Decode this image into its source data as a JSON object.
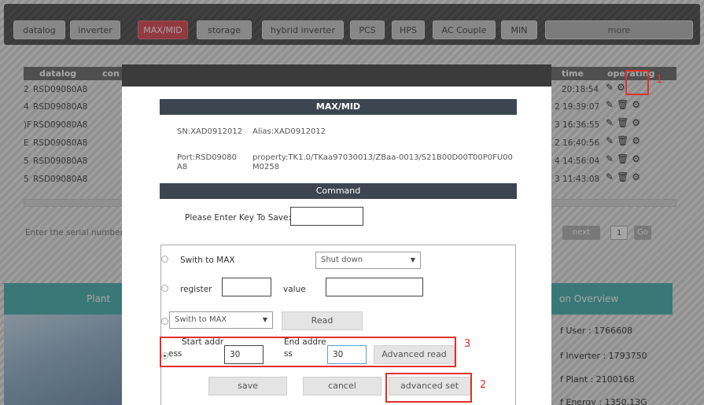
{
  "nav": {
    "tabs": [
      "datalog",
      "inverter",
      "MAX/MID",
      "storage",
      "hybrid inverter",
      "PCS",
      "HPS",
      "AC Couple",
      "MIN",
      "more"
    ],
    "active_tab": "MAX/MID"
  },
  "table": {
    "columns": {
      "datalog": "datalog",
      "con": "con",
      "time": "time",
      "operating": "operating"
    },
    "rows": [
      {
        "idx": "2",
        "datalog": "RSD09080A8",
        "time": "20:18:54"
      },
      {
        "idx": "4",
        "datalog": "RSD09080A8",
        "time": "2 19:39:07"
      },
      {
        "idx": ")F",
        "datalog": "RSD09080A8",
        "time": "3 16:36:55"
      },
      {
        "idx": "E",
        "datalog": "RSD09080A8",
        "time": "2 16:40:56"
      },
      {
        "idx": "5",
        "datalog": "RSD09080A8",
        "time": "4 14:56:04"
      },
      {
        "idx": "5",
        "datalog": "RSD09080A8",
        "time": "3 11:43:08"
      }
    ],
    "search_placeholder": "Enter the serial number",
    "pager": {
      "next": "next",
      "page": "1",
      "go": "Go"
    }
  },
  "panels": {
    "left_title": "Plant In",
    "right_title": "on Overview",
    "overview": [
      "f User : 1766608",
      "f Inverter : 1793750",
      "f Plant : 2100168",
      "f Energy : 1350.13G"
    ]
  },
  "modal": {
    "header_title": "MAX/MID",
    "sn": "SN:XAD0912012",
    "alias": "Alias:XAD0912012",
    "port_line1": "Port:RSD09080",
    "port_line2": "A8",
    "property_line1": "property:TK1.0/TKaa97030013/ZBaa-0013/S21B00D00T00P0FU00",
    "property_line2": "M0258",
    "command_title": "Command",
    "key_label": "Please Enter Key To Save:",
    "key_value": "",
    "switch_label": "Swith to MAX",
    "switch_select": "Shut down",
    "register_label": "register",
    "register_value": "",
    "value_label": "value",
    "value_value": "",
    "switch_select2": "Swith to MAX",
    "read_button": "Read",
    "start_label_1": "Start addr",
    "start_label_2": "ess",
    "start_value": "30",
    "end_label_1": "End addre",
    "end_label_2": "ss",
    "end_value": "30",
    "advanced_read_button": "Advanced read",
    "save_button": "save",
    "cancel_button": "cancel",
    "advanced_set_button": "advanced set"
  },
  "annotations": {
    "one": "1",
    "two": "2",
    "three": "3"
  },
  "colors": {
    "active_tab": "#e05a64",
    "teal": "#59b8b8",
    "annotation": "#e0302a",
    "section_header": "#3d4650"
  },
  "icons": {
    "edit": "edit-icon",
    "delete": "trash-icon",
    "settings": "gear-icon"
  }
}
